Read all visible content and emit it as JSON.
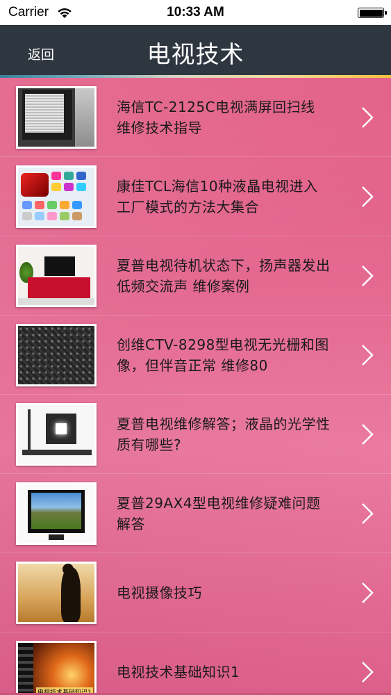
{
  "status_bar": {
    "carrier": "Carrier",
    "time": "10:33 AM"
  },
  "nav": {
    "back_label": "返回",
    "title": "电视技术"
  },
  "list": {
    "items": [
      {
        "line1": "海信TC-2125C电视满屏回扫线",
        "line2": "维修技术指导"
      },
      {
        "line1": "康佳TCL海信10种液晶电视进入",
        "line2": "工厂模式的方法大集合"
      },
      {
        "line1": "夏普电视待机状态下，扬声器发出",
        "line2": "低频交流声 维修案例"
      },
      {
        "line1": "创维CTV-8298型电视无光栅和图",
        "line2": "像，但伴音正常 维修80"
      },
      {
        "line1": "夏普电视维修解答；液晶的光学性",
        "line2": "质有哪些?"
      },
      {
        "line1": "夏普29AX4型电视维修疑难问题",
        "line2": "解答"
      },
      {
        "line1": "电视摄像技巧",
        "line2": ""
      },
      {
        "line1": "电视技术基础知识1",
        "line2": ""
      }
    ],
    "thumb_caption_last": "电视技术基础知识1"
  },
  "colors": {
    "nav_bg": "#2e3640",
    "list_bg": "#e46a92",
    "text": "#1a1a1a"
  },
  "icons": {
    "wifi": "wifi-icon",
    "battery": "battery-icon",
    "chevron": "chevron-right-icon"
  }
}
